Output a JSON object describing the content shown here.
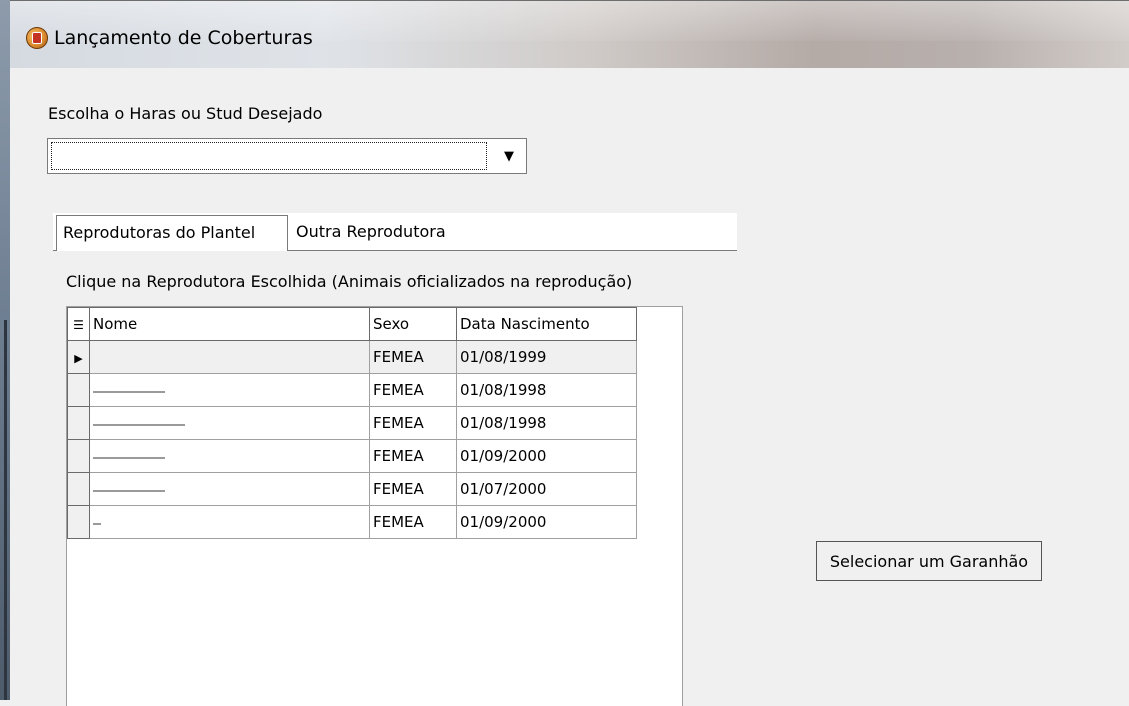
{
  "window": {
    "title": "Lançamento de Coberturas"
  },
  "haras_label": "Escolha o Haras ou Stud Desejado",
  "haras_combo": {
    "value": ""
  },
  "tabs": [
    {
      "label": "Reprodutoras do Plantel",
      "selected": true
    },
    {
      "label": "Outra Reprodutora",
      "selected": false
    }
  ],
  "instruction": "Clique na Reprodutora Escolhida (Animais oficializados na reprodução)",
  "grid": {
    "columns": [
      "Nome",
      "Sexo",
      "Data Nascimento"
    ],
    "rows": [
      {
        "nome": "",
        "sexo": "FEMEA",
        "data": "01/08/1999"
      },
      {
        "nome": "",
        "sexo": "FEMEA",
        "data": "01/08/1998"
      },
      {
        "nome": "",
        "sexo": "FEMEA",
        "data": "01/08/1998"
      },
      {
        "nome": "",
        "sexo": "FEMEA",
        "data": "01/09/2000"
      },
      {
        "nome": "",
        "sexo": "FEMEA",
        "data": "01/07/2000"
      },
      {
        "nome": "",
        "sexo": "FEMEA",
        "data": "01/09/2000"
      }
    ]
  },
  "select_stallion_button": "Selecionar um Garanhão"
}
